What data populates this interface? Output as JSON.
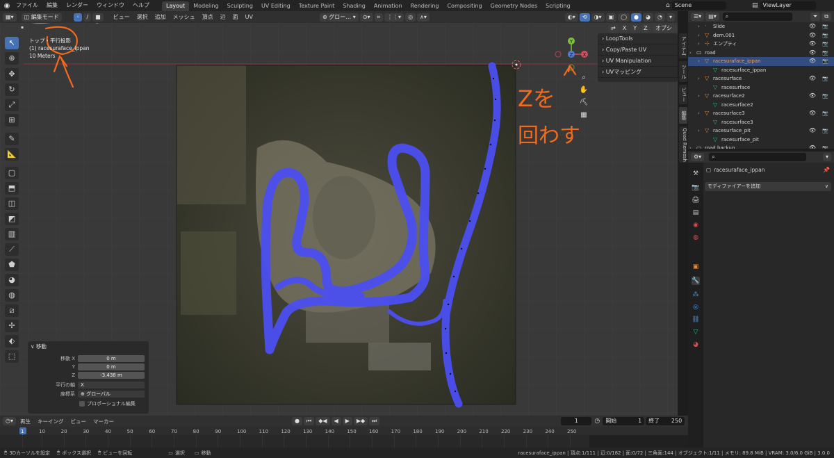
{
  "menubar": {
    "items": [
      "ファイル",
      "編集",
      "レンダー",
      "ウィンドウ",
      "ヘルプ"
    ],
    "workspaces": [
      "Layout",
      "Modeling",
      "Sculpting",
      "UV Editing",
      "Texture Paint",
      "Shading",
      "Animation",
      "Rendering",
      "Compositing",
      "Geometry Nodes",
      "Scripting"
    ],
    "active_workspace": "Layout",
    "scene": "Scene",
    "view_layer": "ViewLayer"
  },
  "viewport_header": {
    "mode": "編集モード",
    "menus": [
      "ビュー",
      "選択",
      "追加",
      "メッシュ",
      "頂点",
      "辺",
      "面",
      "UV"
    ],
    "transform_orientation": "グロー…",
    "options_label": "オプション",
    "axes": [
      "X",
      "Y",
      "Z"
    ]
  },
  "viewport": {
    "view_name": "トップ・平行投影",
    "object_line": "(1) racesuraface_ippan",
    "scale_text": "10 Meters",
    "n_panels": [
      "LoopTools",
      "Copy/Paste UV",
      "UV Manipulation",
      "UVマッピング"
    ],
    "n_tabs": [
      "アイテム",
      "ツール",
      "ビュー",
      "編集",
      "Quad Remesh"
    ],
    "gizmo_labels": [
      "Y",
      "Z",
      "X"
    ],
    "annotation": {
      "text_line1": "Zを",
      "text_line2": "回わす",
      "color": "#f26a1b"
    }
  },
  "operator_panel": {
    "title": "移動",
    "rows": [
      {
        "label": "移動 X",
        "value": "0 m"
      },
      {
        "label": "Y",
        "value": "0 m"
      },
      {
        "label": "Z",
        "value": "-3.438 m"
      },
      {
        "label": "平行の軸",
        "value": "X"
      },
      {
        "label": "座標系",
        "value": "グローバル"
      }
    ],
    "checkbox_label": "プロポーショナル編集"
  },
  "outliner": {
    "rows": [
      {
        "name": "Slide",
        "icon": ""
      },
      {
        "name": "dem.001",
        "icon": "mesh"
      },
      {
        "name": "エンプティ",
        "icon": "empty"
      },
      {
        "name": "road",
        "icon": "collection"
      },
      {
        "name": "racesuraface_ippan",
        "icon": "mesh",
        "selected": true
      },
      {
        "name": "racesurface_ippan",
        "icon": "data"
      },
      {
        "name": "racesurface",
        "icon": "mesh"
      },
      {
        "name": "racesurface",
        "icon": "data"
      },
      {
        "name": "racesurface2",
        "icon": "mesh"
      },
      {
        "name": "racesurface2",
        "icon": "data"
      },
      {
        "name": "racesurface3",
        "icon": "mesh"
      },
      {
        "name": "racesurface3",
        "icon": "data"
      },
      {
        "name": "racesurface_pit",
        "icon": "mesh"
      },
      {
        "name": "racesurface_pit",
        "icon": "data"
      },
      {
        "name": "road backup",
        "icon": "collection"
      }
    ]
  },
  "properties": {
    "object_name": "racesuraface_ippan",
    "add_modifier": "モディファイアーを追加"
  },
  "timeline": {
    "menus": [
      "再生",
      "キーイング",
      "ビュー",
      "マーカー"
    ],
    "current_frame": "1",
    "start_label": "開始",
    "start": "1",
    "end_label": "終了",
    "end": "250",
    "ticks": [
      "1",
      "10",
      "20",
      "30",
      "40",
      "50",
      "60",
      "70",
      "80",
      "90",
      "100",
      "110",
      "120",
      "130",
      "140",
      "150",
      "160",
      "170",
      "180",
      "190",
      "200",
      "210",
      "220",
      "230",
      "240",
      "250"
    ]
  },
  "statusbar": {
    "left": [
      "3Dカーソルを設定",
      "ボックス選択",
      "ビューを回転",
      "選択",
      "移動"
    ],
    "right": "racesuraface_ippan | 頂点:1/111 | 辺:0/182 | 面:0/72 | 三角面:144 | オブジェクト:1/11 | メモリ: 89.8 MiB | VRAM: 3.0/6.0 GiB | 3.0.0"
  }
}
